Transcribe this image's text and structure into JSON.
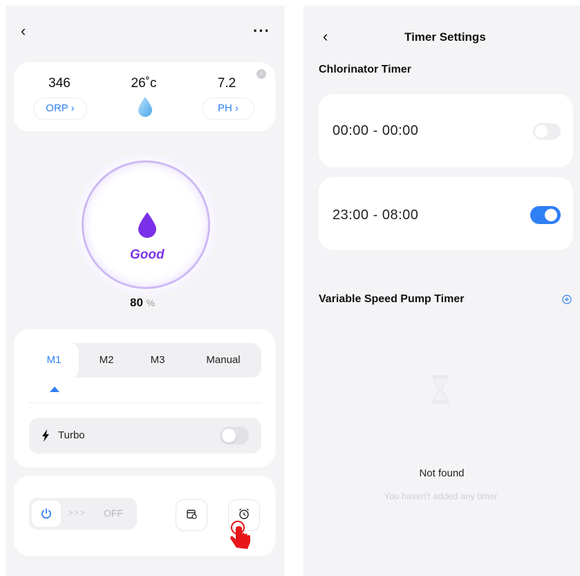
{
  "left": {
    "back_glyph": "‹",
    "more_glyph": "···",
    "sensors": {
      "orp_value": "346",
      "temp_value": "26˚c",
      "ph_value": "7.2",
      "orp_button": "ORP ›",
      "ph_button": "PH ›"
    },
    "gauge": {
      "status": "Good",
      "percent_value": "80",
      "percent_unit": "%"
    },
    "modes": {
      "items": [
        "M1",
        "M2",
        "M3",
        "Manual"
      ],
      "selected": "M1"
    },
    "turbo": {
      "label": "Turbo",
      "enabled": false
    },
    "power": {
      "arrows": ">>>",
      "state_label": "OFF"
    }
  },
  "right": {
    "back_glyph": "‹",
    "title": "Timer Settings",
    "chlorinator": {
      "heading": "Chlorinator Timer",
      "timers": [
        {
          "range": "00:00 - 00:00",
          "enabled": false
        },
        {
          "range": "23:00 - 08:00",
          "enabled": true
        }
      ]
    },
    "pump": {
      "heading": "Variable Speed Pump Timer",
      "empty_title": "Not found",
      "empty_subtitle": "You haven't added any timer."
    }
  },
  "colors": {
    "accent_blue": "#2f7ff5",
    "accent_purple": "#7a35e6",
    "hand_red": "#e8161b"
  },
  "icons": [
    "back-icon",
    "more-icon",
    "water-drop-icon",
    "purple-drop-icon",
    "info-icon",
    "caret-up-icon",
    "lightning-icon",
    "power-icon",
    "schedule-icon",
    "alarm-clock-icon",
    "pointing-hand-icon",
    "add-circle-icon",
    "hourglass-icon"
  ]
}
